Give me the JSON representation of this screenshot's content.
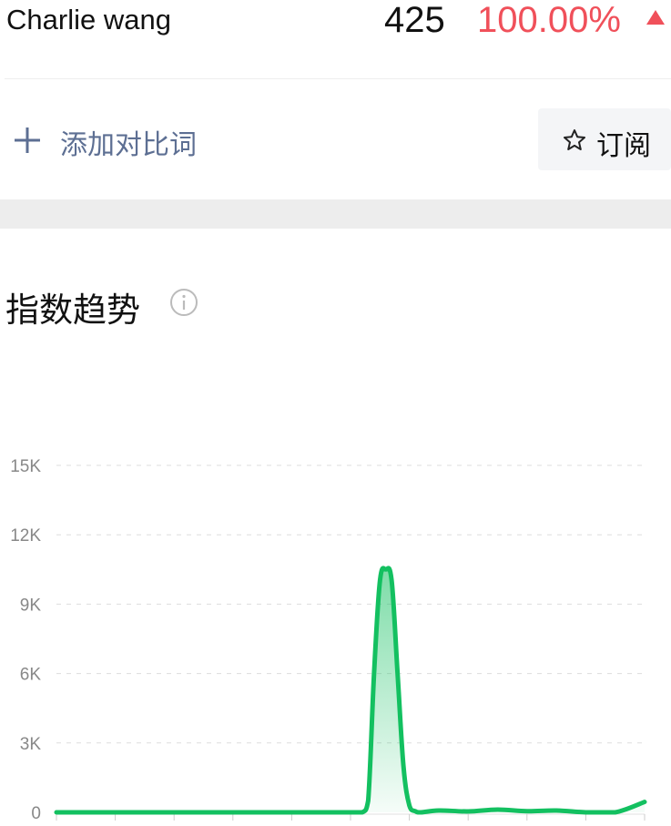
{
  "header": {
    "name": "Charlie wang",
    "count": "425",
    "change": "100.00%",
    "trend_icon": "triangle-up-icon"
  },
  "actions": {
    "add_label": "添加对比词",
    "add_icon": "plus-icon",
    "subscribe_label": "订阅",
    "subscribe_icon": "star-icon"
  },
  "section": {
    "title": "指数趋势",
    "info_icon": "info-icon"
  },
  "colors": {
    "accent_red": "#f0505a",
    "line_green": "#13c060",
    "link_blue": "#5d6f93"
  },
  "chart_data": {
    "type": "area",
    "title": "",
    "xlabel": "",
    "ylabel": "",
    "y_ticks": [
      "0",
      "3K",
      "6K",
      "9K",
      "12K",
      "15K"
    ],
    "y_tick_values": [
      0,
      3000,
      6000,
      9000,
      12000,
      15000
    ],
    "ylim": [
      0,
      15000
    ],
    "grid": true,
    "x": [
      0,
      5,
      10,
      15,
      20,
      25,
      30,
      35,
      40,
      45,
      50,
      52,
      53,
      54,
      55,
      56,
      57,
      58,
      59,
      60,
      61,
      62,
      65,
      70,
      75,
      80,
      85,
      90,
      95,
      100
    ],
    "series": [
      {
        "values": [
          0,
          0,
          0,
          0,
          0,
          0,
          0,
          0,
          0,
          0,
          0,
          0,
          500,
          6000,
          10000,
          10500,
          10000,
          6000,
          2000,
          300,
          50,
          0,
          80,
          40,
          120,
          50,
          80,
          0,
          0,
          450
        ]
      }
    ]
  }
}
